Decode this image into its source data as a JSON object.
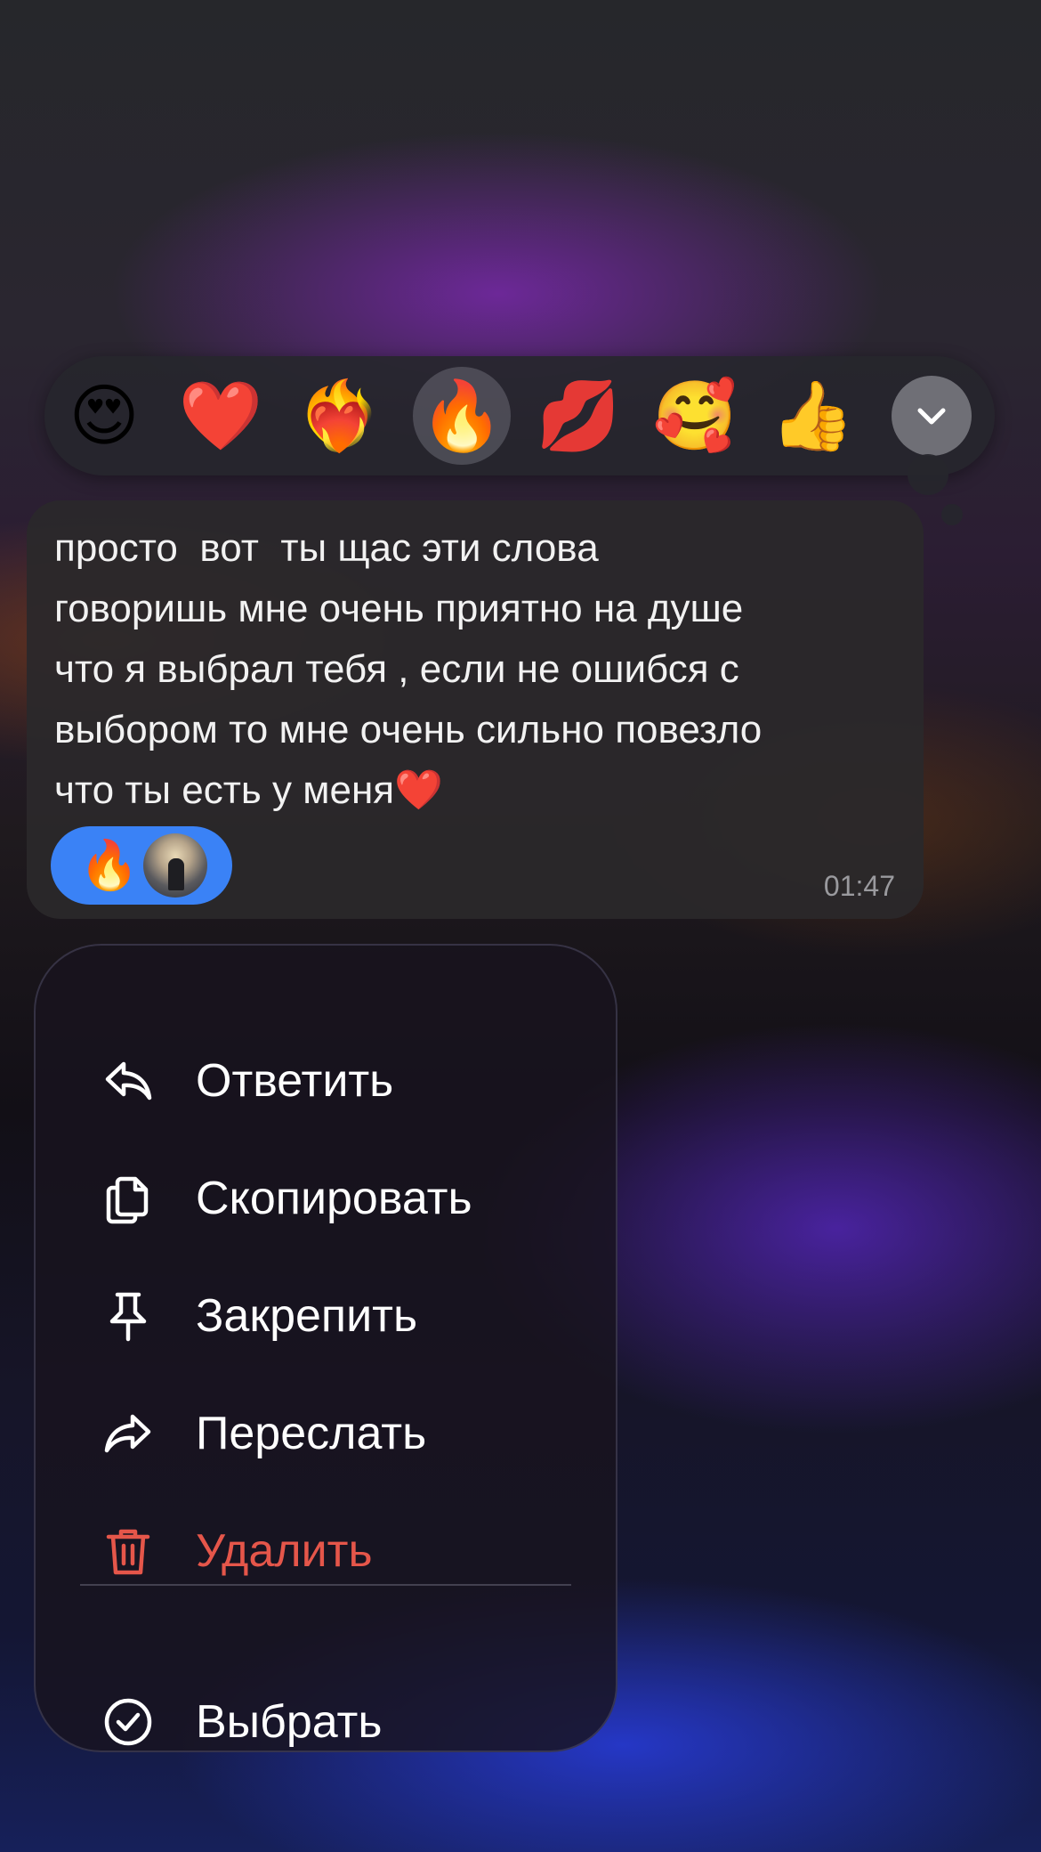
{
  "reactions": [
    {
      "emoji": "😍",
      "icon": "heart-eyes-emoji"
    },
    {
      "emoji": "❤️",
      "icon": "red-heart-emoji"
    },
    {
      "emoji": "❤️‍🔥",
      "icon": "heart-on-fire-emoji"
    },
    {
      "emoji": "🔥",
      "icon": "fire-emoji",
      "selected": true
    },
    {
      "emoji": "💋",
      "icon": "kiss-mark-emoji"
    },
    {
      "emoji": "🥰",
      "icon": "smiling-hearts-emoji"
    },
    {
      "emoji": "👍",
      "icon": "thumbs-up-emoji"
    }
  ],
  "message": {
    "text": "просто  вот  ты щас эти слова\nговоришь мне очень приятно на душе\nчто я выбрал тебя , если не ошибся с\nвыбором то мне очень сильно повезло\nчто ты есть у меня",
    "trailing_emoji": "❤️",
    "reaction_chip": {
      "emoji": "🔥"
    },
    "time": "01:47"
  },
  "menu": {
    "items": [
      {
        "label": "Ответить",
        "icon": "reply-icon"
      },
      {
        "label": "Скопировать",
        "icon": "copy-icon"
      },
      {
        "label": "Закрепить",
        "icon": "pin-icon"
      },
      {
        "label": "Переслать",
        "icon": "forward-icon"
      },
      {
        "label": "Удалить",
        "icon": "trash-icon",
        "danger": true
      }
    ],
    "select_label": "Выбрать"
  },
  "colors": {
    "chip": "#3a82f6",
    "danger": "#e5564a"
  }
}
